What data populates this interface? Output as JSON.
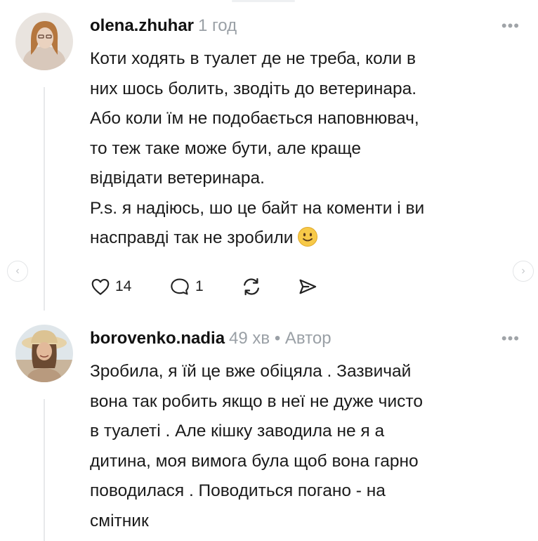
{
  "comments": [
    {
      "username": "olena.zhuhar",
      "meta": "1 год",
      "more": "•••",
      "body": [
        "Коти ходять в туалет де не треба, коли в",
        "них шось болить, зводіть до ветеринара.",
        "Або коли їм не подобається наповнювач,",
        "то теж таке може бути, але краще",
        "відвідати ветеринара.",
        "P.s. я надіюсь, шо це байт на коменти і ви",
        "насправді так не зробили"
      ],
      "emoji": "slightly-smiling-face",
      "actions": {
        "likes": "14",
        "replies": "1"
      }
    },
    {
      "username": "borovenko.nadia",
      "meta": "49 хв • Автор",
      "more": "•••",
      "body": [
        "Зробила, я їй це вже обіцяла . Зазвичай",
        "вона так робить якщо в неї не дуже чисто",
        "в туалеті . Але кішку заводила не я а",
        "дитина, моя вимога була щоб вона гарно",
        "поводилася . Поводиться погано - на",
        "смітник"
      ]
    }
  ],
  "nav": {
    "prev": "‹",
    "next": "›"
  },
  "colors": {
    "meta": "#9aa0a6",
    "text": "#1a1a1a",
    "icon": "#222222",
    "emoji": "#f7c948"
  }
}
